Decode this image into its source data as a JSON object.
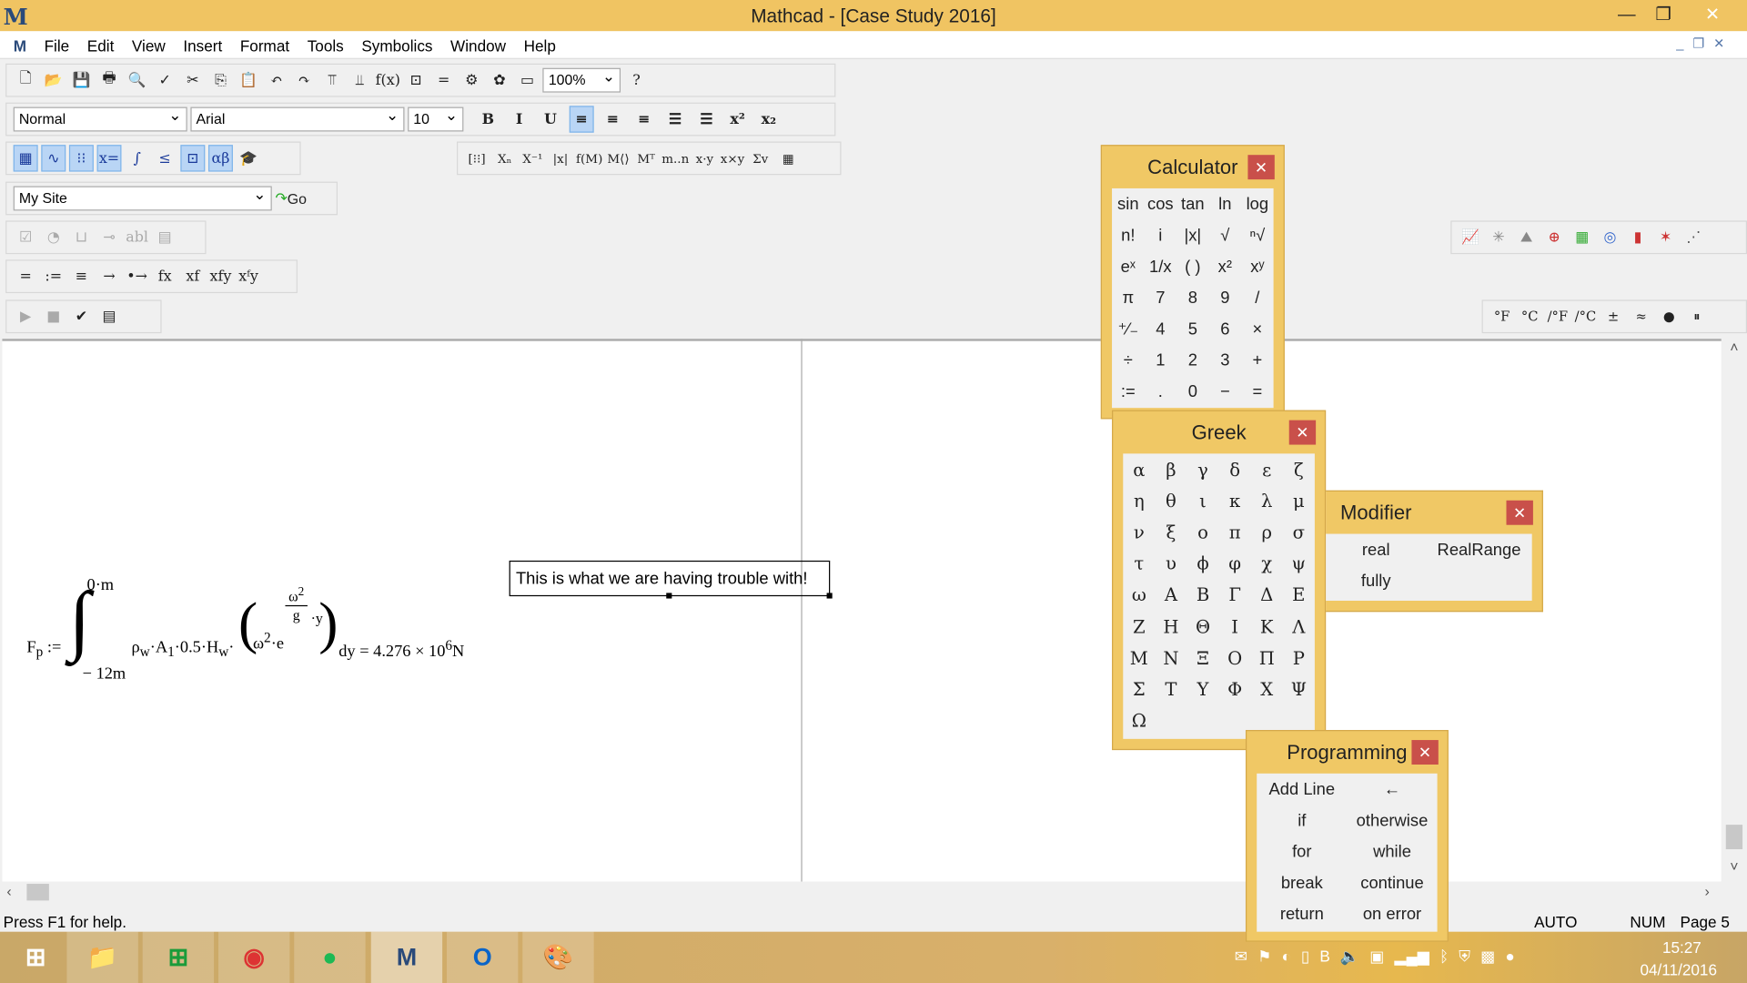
{
  "window": {
    "title": "Mathcad - [Case Study 2016]",
    "logo": "M",
    "controls": [
      "minimize",
      "restore",
      "close"
    ]
  },
  "menu": [
    "File",
    "Edit",
    "View",
    "Insert",
    "Format",
    "Tools",
    "Symbolics",
    "Window",
    "Help"
  ],
  "toolbar": {
    "zoom": "100%",
    "style": "Normal",
    "font": "Arial",
    "size": "10",
    "format_buttons": [
      {
        "icon": "bold",
        "label": "B"
      },
      {
        "icon": "italic",
        "label": "I"
      },
      {
        "icon": "underline",
        "label": "U"
      },
      {
        "icon": "align-left",
        "label": "≡"
      },
      {
        "icon": "align-center",
        "label": "≡"
      },
      {
        "icon": "align-right",
        "label": "≡"
      },
      {
        "icon": "bullets",
        "label": "☰"
      },
      {
        "icon": "numbering",
        "label": "☰"
      },
      {
        "icon": "superscript",
        "label": "x²"
      },
      {
        "icon": "subscript",
        "label": "x₂"
      }
    ],
    "standard": [
      "new",
      "open",
      "save",
      "print",
      "print-preview",
      "spell-check",
      "cut",
      "copy",
      "paste",
      "undo",
      "redo",
      "align-top",
      "align-down",
      "insert-function",
      "insert-unit",
      "calculate",
      "component",
      "resource",
      "region",
      "help"
    ],
    "math": [
      {
        "icon": "calculator",
        "label": "▦"
      },
      {
        "icon": "graph",
        "label": "∿"
      },
      {
        "icon": "matrix",
        "label": "⁝⁝"
      },
      {
        "icon": "evaluation",
        "label": "x="
      },
      {
        "icon": "calculus",
        "label": "∫"
      },
      {
        "icon": "boolean",
        "label": "≤"
      },
      {
        "icon": "programming",
        "label": "⊡"
      },
      {
        "icon": "greek",
        "label": "αβ"
      },
      {
        "icon": "symbolic",
        "label": "🎓"
      }
    ],
    "matrix": [
      "[⁝⁝]",
      "Xₙ",
      "X⁻¹",
      "|x|",
      "f(M)",
      "M⟨⟩",
      "Mᵀ",
      "m..n",
      "x·y",
      "x×y",
      "Σv",
      "▦"
    ],
    "resource": {
      "value": "My Site",
      "go": "Go"
    },
    "controls": [
      "☑",
      "◔",
      "⊔",
      "⊸",
      "abl",
      "▤"
    ],
    "evaluation": [
      "=",
      ":=",
      "≡",
      "→",
      "•→",
      "fx",
      "xf",
      "xfy",
      "xᶠy"
    ],
    "debug": [
      "▶",
      "■",
      "✔",
      "▤"
    ],
    "graph": [
      "x-y plot",
      "polar plot",
      "surface plot",
      "contour",
      "3d bar",
      "3d scatter",
      "vector field",
      "bar",
      "scatter"
    ],
    "units": [
      "°F",
      "°C",
      "/°F",
      "/°C",
      "±",
      "≈",
      "●",
      "⏸"
    ]
  },
  "document": {
    "equation": {
      "lhs": "F",
      "lhs_sub": "p",
      "assign": ":=",
      "upper": "0·m",
      "lower": "− 12m",
      "body": "ρ",
      "body_sub": "w",
      "mid": "·A",
      "mid_sub": "1",
      "rest": "·0.5·H",
      "rest_sub": "w",
      "dot": "·",
      "omega": "ω",
      "sq": "2",
      "e": "·e",
      "frac_num": "ω",
      "frac_den": "g",
      "frac_y": "·y",
      "dy": "dy = 4.276 × 10",
      "exp": "6",
      "unit": "N"
    },
    "text_region": "This is what we are having trouble with!"
  },
  "status": {
    "help": "Press F1 for help.",
    "auto": "AUTO",
    "num": "NUM",
    "page": "Page 5"
  },
  "calculator": {
    "title": "Calculator",
    "keys": [
      "sin",
      "cos",
      "tan",
      "ln",
      "log",
      "n!",
      "i",
      "|x|",
      "√",
      "ⁿ√",
      "eˣ",
      "1/x",
      "( )",
      "x²",
      "xʸ",
      "π",
      "7",
      "8",
      "9",
      "/",
      "⁺⁄₋",
      "4",
      "5",
      "6",
      "×",
      "÷",
      "1",
      "2",
      "3",
      "+",
      ":=",
      ".",
      "0",
      "−",
      "="
    ]
  },
  "greek": {
    "title": "Greek",
    "keys": [
      "α",
      "β",
      "γ",
      "δ",
      "ε",
      "ζ",
      "η",
      "θ",
      "ι",
      "κ",
      "λ",
      "μ",
      "ν",
      "ξ",
      "ο",
      "π",
      "ρ",
      "σ",
      "τ",
      "υ",
      "ϕ",
      "φ",
      "χ",
      "ψ",
      "ω",
      "Α",
      "Β",
      "Γ",
      "Δ",
      "Ε",
      "Ζ",
      "Η",
      "Θ",
      "Ι",
      "Κ",
      "Λ",
      "Μ",
      "Ν",
      "Ξ",
      "Ο",
      "Π",
      "Ρ",
      "Σ",
      "Τ",
      "Υ",
      "Φ",
      "Χ",
      "Ψ",
      "Ω"
    ]
  },
  "modifier": {
    "title": "Modifier",
    "keys": [
      "real",
      "RealRange",
      "fully"
    ]
  },
  "programming": {
    "title": "Programming",
    "keys": [
      "Add Line",
      "←",
      "if",
      "otherwise",
      "for",
      "while",
      "break",
      "continue",
      "return",
      "on error"
    ]
  },
  "taskbar": {
    "apps": [
      "start",
      "file-explorer",
      "store",
      "chrome",
      "spotify",
      "mathcad",
      "outlook",
      "paint"
    ],
    "time": "15:27",
    "date": "04/11/2016",
    "tray": [
      "outlook",
      "flag",
      "acrobat",
      "battery",
      "b-app",
      "volume",
      "intel",
      "signal",
      "bluetooth",
      "security",
      "bo",
      "spotify"
    ]
  },
  "colors": {
    "titlebar": "#f0c462",
    "panel": "#f0c865",
    "close": "#c9504a"
  }
}
